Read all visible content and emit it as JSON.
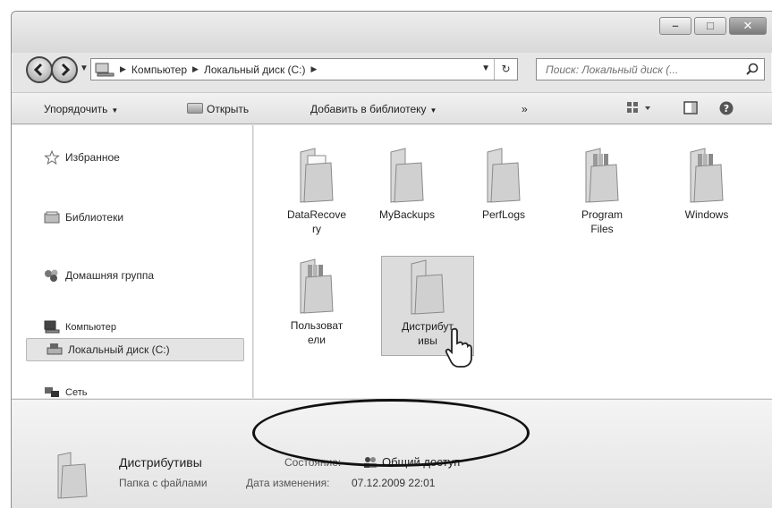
{
  "address_bar": {
    "crumbs": [
      "Компьютер",
      "Локальный диск (C:)"
    ],
    "search_placeholder": "Поиск: Локальный диск (..."
  },
  "toolbar": {
    "organize": "Упорядочить",
    "open": "Открыть",
    "add_to_library": "Добавить в библиотеку",
    "more": "»"
  },
  "nav_pane": {
    "favorites": "Избранное",
    "libraries": "Библиотеки",
    "homegroup": "Домашняя группа",
    "computer": "Компьютер",
    "local_disk": "Локальный диск (C:)",
    "network": "Сеть"
  },
  "files": [
    {
      "name": "DataRecove\nry",
      "icon": "folder-document-icon"
    },
    {
      "name": "MyBackups",
      "icon": "folder-icon"
    },
    {
      "name": "PerfLogs",
      "icon": "folder-icon"
    },
    {
      "name": "Program\nFiles",
      "icon": "folder-files-icon"
    },
    {
      "name": "Windows",
      "icon": "folder-files-icon"
    },
    {
      "name": "Пользоват\nели",
      "icon": "folder-files-icon"
    },
    {
      "name": "Дистрибут\nивы",
      "icon": "folder-icon",
      "selected": true
    }
  ],
  "details": {
    "name": "Дистрибутивы",
    "type": "Папка с файлами",
    "state_label": "Состояние:",
    "state_value": "Общий доступ",
    "date_label": "Дата изменения:",
    "date_value": "07.12.2009 22:01"
  }
}
